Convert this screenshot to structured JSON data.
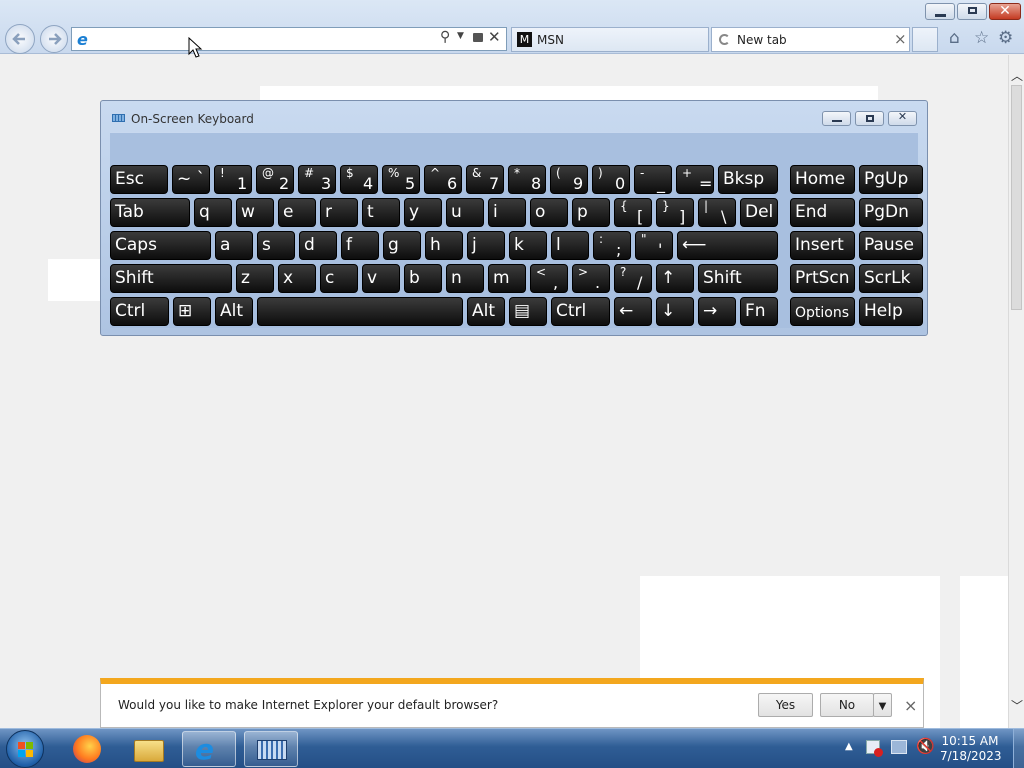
{
  "browser": {
    "address_value": "",
    "tabs": [
      {
        "label": "MSN",
        "active": false
      },
      {
        "label": "New tab",
        "active": true
      }
    ],
    "tab_close_glyph": "×"
  },
  "osk": {
    "title": "On-Screen Keyboard",
    "rows": [
      [
        {
          "main": "Esc",
          "w": 58
        },
        {
          "main": "~ `",
          "w": 38
        },
        {
          "shift": "!",
          "base": "1",
          "w": 38
        },
        {
          "shift": "@",
          "base": "2",
          "w": 38
        },
        {
          "shift": "#",
          "base": "3",
          "w": 38
        },
        {
          "shift": "$",
          "base": "4",
          "w": 38
        },
        {
          "shift": "%",
          "base": "5",
          "w": 38
        },
        {
          "shift": "^",
          "base": "6",
          "w": 38
        },
        {
          "shift": "&",
          "base": "7",
          "w": 38
        },
        {
          "shift": "*",
          "base": "8",
          "w": 38
        },
        {
          "shift": "(",
          "base": "9",
          "w": 38
        },
        {
          "shift": ")",
          "base": "0",
          "w": 38
        },
        {
          "shift": "-",
          "base": "_",
          "w": 38
        },
        {
          "shift": "+",
          "base": "=",
          "w": 38
        },
        {
          "main": "Bksp",
          "w": 60
        },
        {
          "main": "Home",
          "w": 65,
          "gap": 8
        },
        {
          "main": "PgUp",
          "w": 64
        }
      ],
      [
        {
          "main": "Tab",
          "w": 80
        },
        {
          "main": "q",
          "w": 38
        },
        {
          "main": "w",
          "w": 38
        },
        {
          "main": "e",
          "w": 38
        },
        {
          "main": "r",
          "w": 38
        },
        {
          "main": "t",
          "w": 38
        },
        {
          "main": "y",
          "w": 38
        },
        {
          "main": "u",
          "w": 38
        },
        {
          "main": "i",
          "w": 38
        },
        {
          "main": "o",
          "w": 38
        },
        {
          "main": "p",
          "w": 38
        },
        {
          "shift": "{",
          "base": "[",
          "w": 38
        },
        {
          "shift": "}",
          "base": "]",
          "w": 38
        },
        {
          "shift": "|",
          "base": "\\",
          "w": 38
        },
        {
          "main": "Del",
          "w": 38
        },
        {
          "main": "End",
          "w": 65,
          "gap": 8
        },
        {
          "main": "PgDn",
          "w": 64
        }
      ],
      [
        {
          "main": "Caps",
          "w": 101
        },
        {
          "main": "a",
          "w": 38
        },
        {
          "main": "s",
          "w": 38
        },
        {
          "main": "d",
          "w": 38
        },
        {
          "main": "f",
          "w": 38
        },
        {
          "main": "g",
          "w": 38
        },
        {
          "main": "h",
          "w": 38
        },
        {
          "main": "j",
          "w": 38
        },
        {
          "main": "k",
          "w": 38
        },
        {
          "main": "l",
          "w": 38
        },
        {
          "shift": ":",
          "base": ";",
          "w": 38
        },
        {
          "shift": "\"",
          "base": "'",
          "w": 38
        },
        {
          "main": "⟵",
          "w": 101
        },
        {
          "main": "Insert",
          "w": 65,
          "gap": 8
        },
        {
          "main": "Pause",
          "w": 64
        }
      ],
      [
        {
          "main": "Shift",
          "w": 122
        },
        {
          "main": "z",
          "w": 38
        },
        {
          "main": "x",
          "w": 38
        },
        {
          "main": "c",
          "w": 38
        },
        {
          "main": "v",
          "w": 38
        },
        {
          "main": "b",
          "w": 38
        },
        {
          "main": "n",
          "w": 38
        },
        {
          "main": "m",
          "w": 38
        },
        {
          "shift": "<",
          "base": ",",
          "w": 38
        },
        {
          "shift": ">",
          "base": ".",
          "w": 38
        },
        {
          "shift": "?",
          "base": "/",
          "w": 38
        },
        {
          "main": "↑",
          "w": 38
        },
        {
          "main": "Shift",
          "w": 80
        },
        {
          "main": "PrtScn",
          "w": 65,
          "gap": 8
        },
        {
          "main": "ScrLk",
          "w": 64
        }
      ],
      [
        {
          "main": "Ctrl",
          "w": 59
        },
        {
          "main": "⊞",
          "w": 38
        },
        {
          "main": "Alt",
          "w": 38
        },
        {
          "main": "",
          "w": 206
        },
        {
          "main": "Alt",
          "w": 38
        },
        {
          "main": "▤",
          "w": 38
        },
        {
          "main": "Ctrl",
          "w": 59
        },
        {
          "main": "←",
          "w": 38
        },
        {
          "main": "↓",
          "w": 38
        },
        {
          "main": "→",
          "w": 38
        },
        {
          "main": "Fn",
          "w": 38
        },
        {
          "main": "Options",
          "w": 65,
          "gap": 8,
          "opt": true
        },
        {
          "main": "Help",
          "w": 64
        }
      ]
    ]
  },
  "banner": {
    "message": "Would you like to make Internet Explorer your default browser?",
    "yes_label": "Yes",
    "no_label": "No",
    "close_glyph": "×"
  },
  "taskbar": {
    "time": "10:15 AM",
    "date": "7/18/2023"
  }
}
